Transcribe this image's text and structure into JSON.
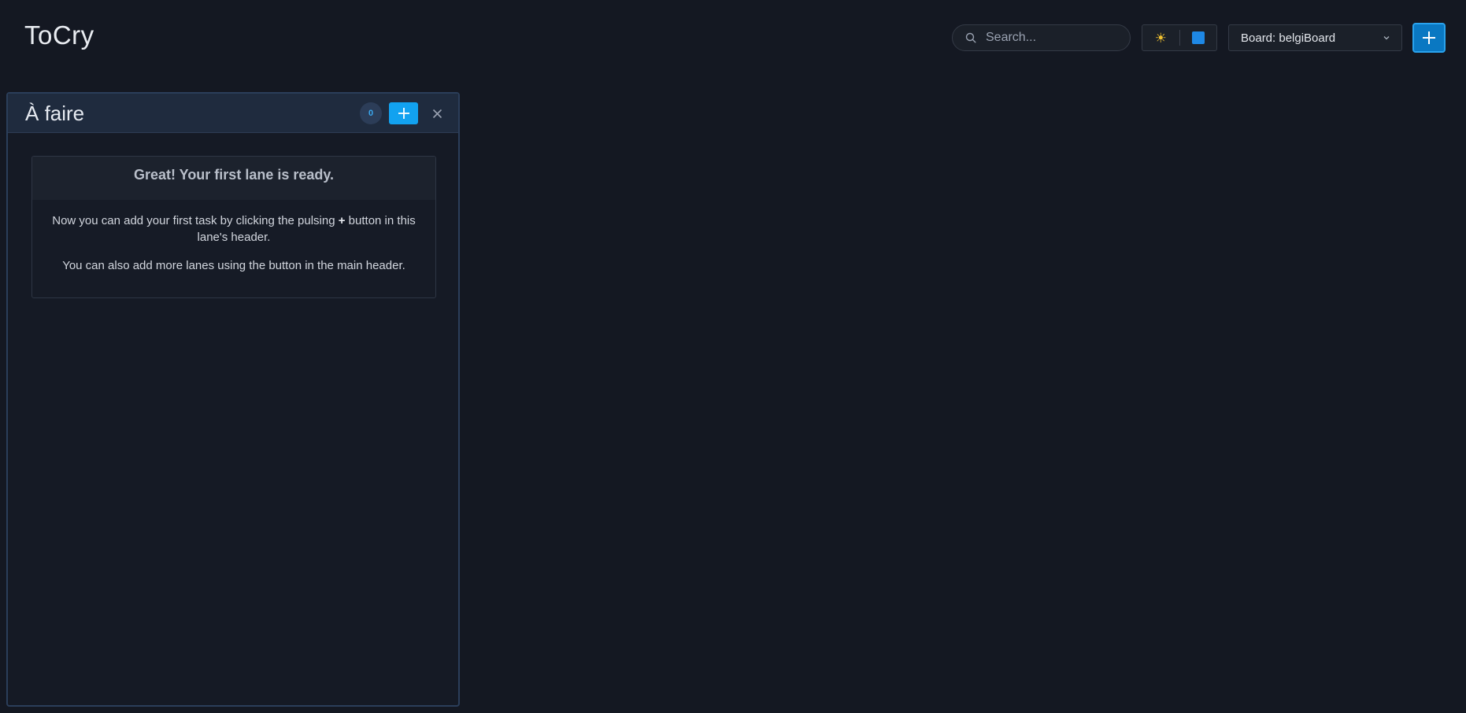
{
  "app": {
    "title": "ToCry"
  },
  "header": {
    "search": {
      "placeholder": "Search..."
    },
    "theme": {
      "sun_icon": "sun-icon",
      "accent_color": "#1e88e5"
    },
    "board_select": {
      "label": "Board: belgiBoard"
    },
    "add_lane": {
      "icon": "plus-icon"
    }
  },
  "lane": {
    "title": "À faire",
    "count": "0",
    "welcome": {
      "title": "Great! Your first lane is ready.",
      "line1_pre": "Now you can add your first task by clicking the pulsing ",
      "line1_plus": "+",
      "line1_post": " button in this lane's header.",
      "line2": "You can also add more lanes using the button in the main header."
    }
  },
  "colors": {
    "background": "#141822",
    "primary": "#12a2f0",
    "lane_border": "#2b3e5a"
  }
}
